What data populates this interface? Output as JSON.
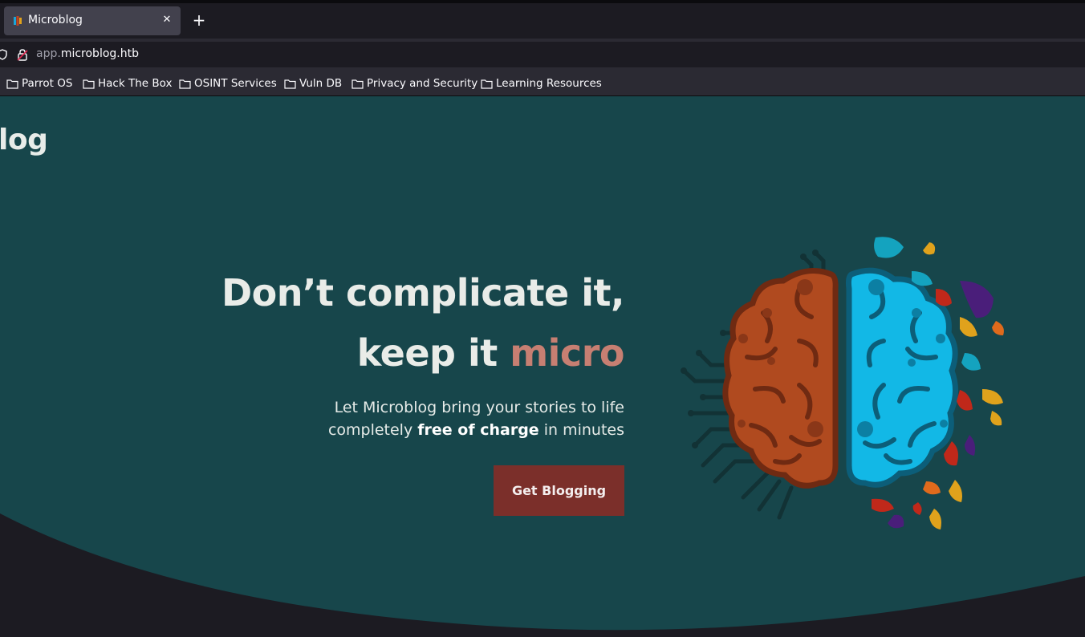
{
  "browser": {
    "tab_title": "Microblog",
    "new_tab_label": "+",
    "url_prefix": "app.",
    "url_host": "microblog.htb",
    "bookmarks": [
      "Parrot OS",
      "Hack The Box",
      "OSINT Services",
      "Vuln DB",
      "Privacy and Security",
      "Learning Resources"
    ]
  },
  "site": {
    "brand": "log",
    "headline_line1": "Don’t complicate it,",
    "headline_line2_plain": "keep it ",
    "headline_line2_accent": "micro",
    "sub_line1": "Let Microblog bring your stories to life",
    "sub_line2_pre": "completely ",
    "sub_line2_bold": "free of charge",
    "sub_line2_post": " in minutes",
    "cta_label": "Get Blogging"
  },
  "colors": {
    "hero_background": "#17464b",
    "accent_text": "#c77f72",
    "cta_background": "#7b2f2a",
    "brain_left": "#b04a1f",
    "brain_right": "#12b8e6"
  },
  "icons": [
    "firefox-favicon",
    "close-icon",
    "plus-icon",
    "shield-icon",
    "lock-icon",
    "folder-icon",
    "brain-illustration"
  ]
}
